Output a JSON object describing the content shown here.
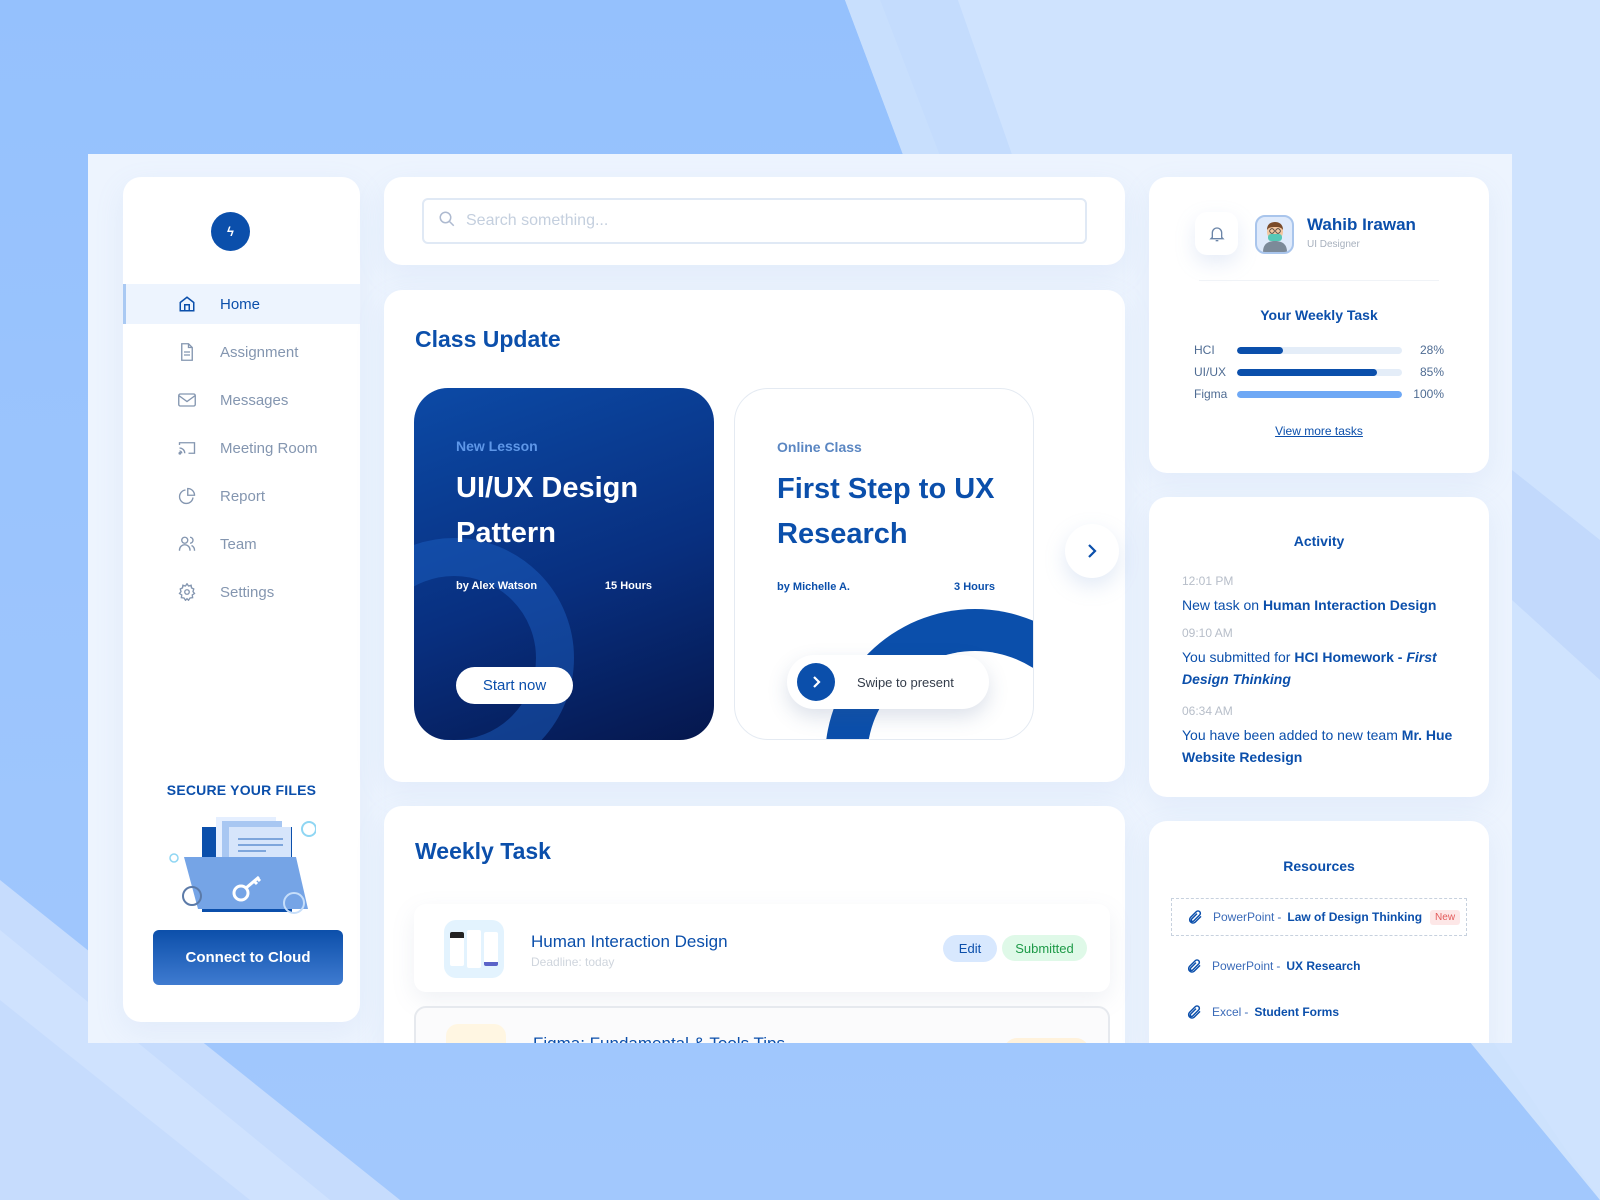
{
  "brand": {
    "logo_glyph": "ϟ"
  },
  "sidebar": {
    "items": [
      {
        "label": "Home",
        "icon": "home-icon",
        "active": true
      },
      {
        "label": "Assignment",
        "icon": "document-icon"
      },
      {
        "label": "Messages",
        "icon": "mail-icon"
      },
      {
        "label": "Meeting Room",
        "icon": "cast-icon"
      },
      {
        "label": "Report",
        "icon": "pie-chart-icon"
      },
      {
        "label": "Team",
        "icon": "team-icon"
      },
      {
        "label": "Settings",
        "icon": "gear-icon"
      }
    ],
    "promo_title": "SECURE YOUR FILES",
    "promo_button": "Connect to Cloud"
  },
  "search": {
    "placeholder": "Search something..."
  },
  "class_update": {
    "title": "Class Update",
    "lessons": [
      {
        "tag": "New Lesson",
        "title": "UI/UX Design Pattern",
        "author": "by Alex Watson",
        "hours": "15 Hours",
        "action": "Start now"
      },
      {
        "tag": "Online Class",
        "title": "First Step to UX Research",
        "author_prefix": "by ",
        "author": "Michelle A.",
        "hours": "3 Hours",
        "action": "Swipe to present"
      }
    ]
  },
  "weekly_task": {
    "title": "Weekly Task",
    "tasks": [
      {
        "name": "Human Interaction Design",
        "deadline": "Deadline: today",
        "edit": "Edit",
        "status": "Submitted"
      },
      {
        "name": "Figma: Fundamental & Tools Tips",
        "deadline": "",
        "status": ""
      }
    ]
  },
  "profile": {
    "name": "Wahib Irawan",
    "role": "UI Designer"
  },
  "your_weekly_task": {
    "title": "Your Weekly Task",
    "items": [
      {
        "label": "HCI",
        "percent": 28,
        "display": "28%",
        "color": "#0b4fab"
      },
      {
        "label": "UI/UX",
        "percent": 85,
        "display": "85%",
        "color": "#0b4fab"
      },
      {
        "label": "Figma",
        "percent": 100,
        "display": "100%",
        "color": "#6ea8f5"
      }
    ],
    "link": "View more tasks"
  },
  "activity": {
    "title": "Activity",
    "items": [
      {
        "time": "12:01 PM",
        "text": "New task on ",
        "bold": "Human Interaction Design",
        "italic": ""
      },
      {
        "time": "09:10 AM",
        "text": "You submitted for ",
        "bold": "HCI Homework - ",
        "italic": "First Design Thinking"
      },
      {
        "time": "06:34 AM",
        "text": "You have been added to new team ",
        "bold": "Mr. Hue Website Redesign",
        "italic": ""
      }
    ]
  },
  "resources": {
    "title": "Resources",
    "items": [
      {
        "type": "PowerPoint",
        "name": "Law of Design Thinking",
        "badge": "New"
      },
      {
        "type": "PowerPoint",
        "name": "UX Research",
        "badge": ""
      },
      {
        "type": "Excel",
        "name": "Student Forms",
        "badge": ""
      }
    ]
  },
  "colors": {
    "primary": "#0b4fab",
    "accent_light": "#6ea8f5",
    "success": "#1e9a48",
    "danger": "#e25a5a"
  }
}
